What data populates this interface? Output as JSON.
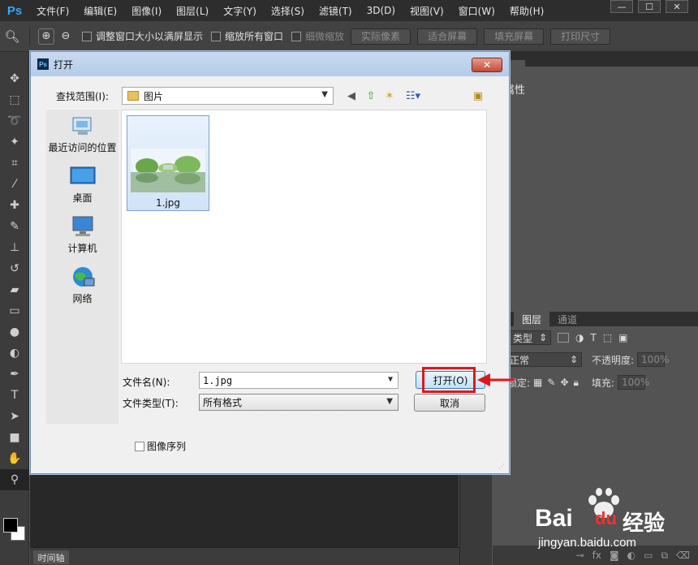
{
  "app": {
    "logo": "Ps"
  },
  "menu": [
    "文件(F)",
    "编辑(E)",
    "图像(I)",
    "图层(L)",
    "文字(Y)",
    "选择(S)",
    "滤镜(T)",
    "3D(D)",
    "视图(V)",
    "窗口(W)",
    "帮助(H)"
  ],
  "window_controls": {
    "minimize": "—",
    "maximize": "☐",
    "close": "✕"
  },
  "options": {
    "resize_windows": "调整窗口大小以满屏显示",
    "zoom_all_windows": "缩放所有窗口",
    "scrubby_zoom": "细微缩放",
    "actual_pixels": "实际像素",
    "fit_screen": "适合屏幕",
    "fill_screen": "填充屏幕",
    "print_size": "打印尺寸"
  },
  "panels": {
    "properties_title": "属性",
    "tabs": [
      "图层",
      "通道"
    ],
    "filter_kind": "类型",
    "blend_mode": "正常",
    "opacity_label": "不透明度:",
    "opacity_value": "100%",
    "lock_label": "锁定:",
    "fill_label": "填充:",
    "fill_value": "100%"
  },
  "timeline_tab": "时间轴",
  "dialog": {
    "title": "打开",
    "app_icon": "Ps",
    "close_label": "✕",
    "look_in_label": "查找范围(I):",
    "look_in_value": "图片",
    "places": [
      "最近访问的位置",
      "桌面",
      "计算机",
      "网络"
    ],
    "files": [
      {
        "name": "1.jpg"
      }
    ],
    "filename_label": "文件名(N):",
    "filename_value": "1.jpg",
    "filetype_label": "文件类型(T):",
    "filetype_value": "所有格式",
    "open_button": "打开(O)",
    "cancel_button": "取消",
    "image_sequence": "图像序列"
  },
  "watermark": {
    "brand": "Bai",
    "brand_tail": "du",
    "brand_cn": "经验",
    "url": "jingyan.baidu.com"
  }
}
